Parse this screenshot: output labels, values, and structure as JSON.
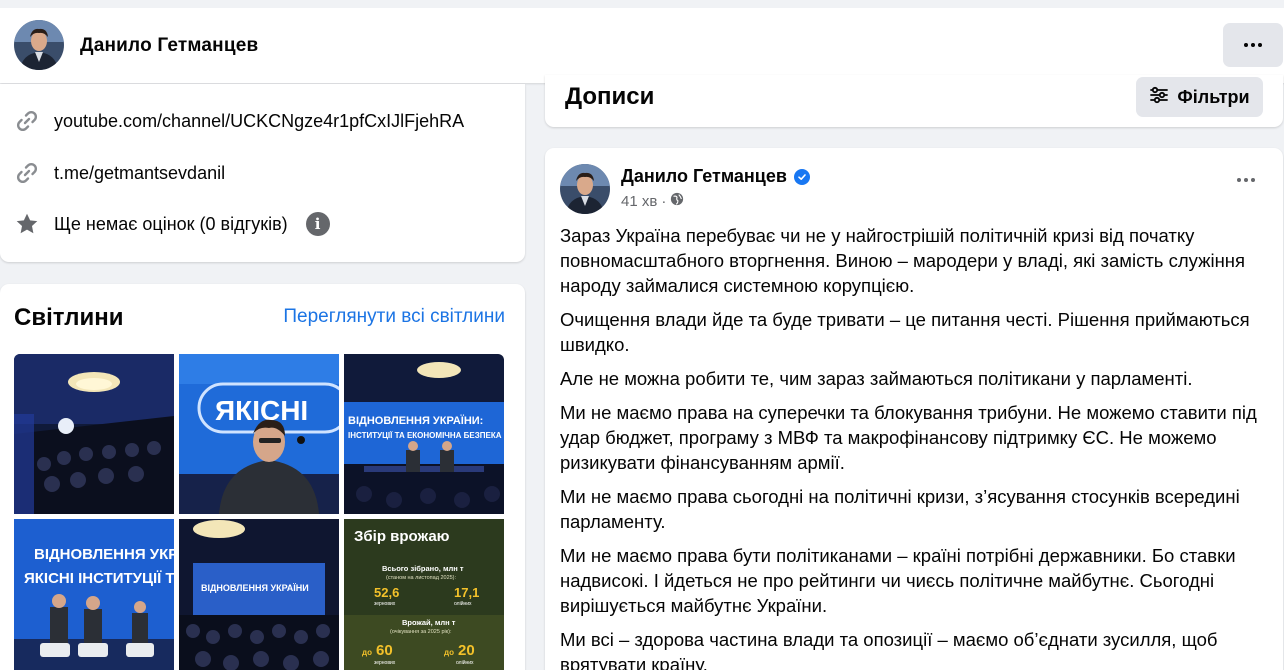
{
  "profile": {
    "name": "Данило Гетманцев"
  },
  "intro": {
    "links": [
      {
        "text": "youtube.com/channel/UCKCNgze4r1pfCxIJlFjehRA",
        "icon": "link-icon"
      },
      {
        "text": "t.me/getmantsevdanil",
        "icon": "link-icon"
      }
    ],
    "rating": "Ще немає оцінок (0 відгуків)"
  },
  "photos": {
    "title": "Світлини",
    "see_all": "Переглянути всі світлини",
    "items": [
      {
        "kind": "hall",
        "caption": ""
      },
      {
        "kind": "speaker",
        "caption": "ЯКІСНІ"
      },
      {
        "kind": "stage",
        "caption": "ВІДНОВЛЕННЯ УКРАЇНИ: ІНСТИТУЦІЇ ТА ЕКОНОМІЧНА БЕЗПЕКА"
      },
      {
        "kind": "panel",
        "caption": "ВІДНОВЛЕННЯ УКРАЇНИ: ЯКІСНІ ІНСТИТУЦІЇ ТА ЕКОНОМІЧНА БЕЗПЕКА"
      },
      {
        "kind": "hall2",
        "caption": ""
      },
      {
        "kind": "infographic",
        "caption": "Збір врожаю"
      }
    ],
    "infographic": {
      "title": "Збір врожаю",
      "total_label": "Всього зібрано, млн т",
      "total_sub": "(станом на листопад 2025):",
      "total_a": "52,6",
      "total_a_unit": "зернових",
      "total_b": "17,1",
      "total_b_unit": "олійних",
      "expected_label": "Врожай, млн т",
      "expected_sub": "(очікування за 2025 рік):",
      "expected_a_prefix": "до",
      "expected_a": "60",
      "expected_a_unit": "зернових",
      "expected_b_prefix": "до",
      "expected_b": "20",
      "expected_b_unit": "олійних"
    }
  },
  "posts_header": {
    "title": "Дописи",
    "filter_label": "Фільтри"
  },
  "post": {
    "author": "Данило Гетманцев",
    "time": "41 хв",
    "separator": "·",
    "paragraphs": [
      "Зараз Україна перебуває чи не у найгострішій політичній кризі від початку повномасштабного вторгнення. Виною – мародери у владі, які замість служіння народу займалися системною корупцією.",
      "Очищення влади йде та буде тривати – це питання честі. Рішення приймаються швидко.",
      "Але не можна робити те, чим зараз займаються політикани у парламенті.",
      "Ми не маємо права на суперечки та блокування трибуни. Не можемо ставити під удар бюджет, програму з МВФ та макрофінансову підтримку ЄС. Не можемо ризикувати фінансуванням армії.",
      "Ми не маємо права сьогодні на політичні кризи, з’ясування стосунків всередині парламенту.",
      "Ми не маємо права бути політиканами – країні потрібні державники. Бо ставки надвисокі. І йдеться не про рейтинги чи чиєсь політичне майбутнє. Сьогодні вирішується майбутнє України.",
      "Ми всі – здорова частина влади та опозиції – маємо об’єднати зусилля, щоб врятувати країну."
    ]
  },
  "colors": {
    "link": "#1b74e4",
    "verified": "#1877f2",
    "muted": "#65676b",
    "button_bg": "#e4e6eb",
    "page_bg": "#f0f2f5"
  }
}
